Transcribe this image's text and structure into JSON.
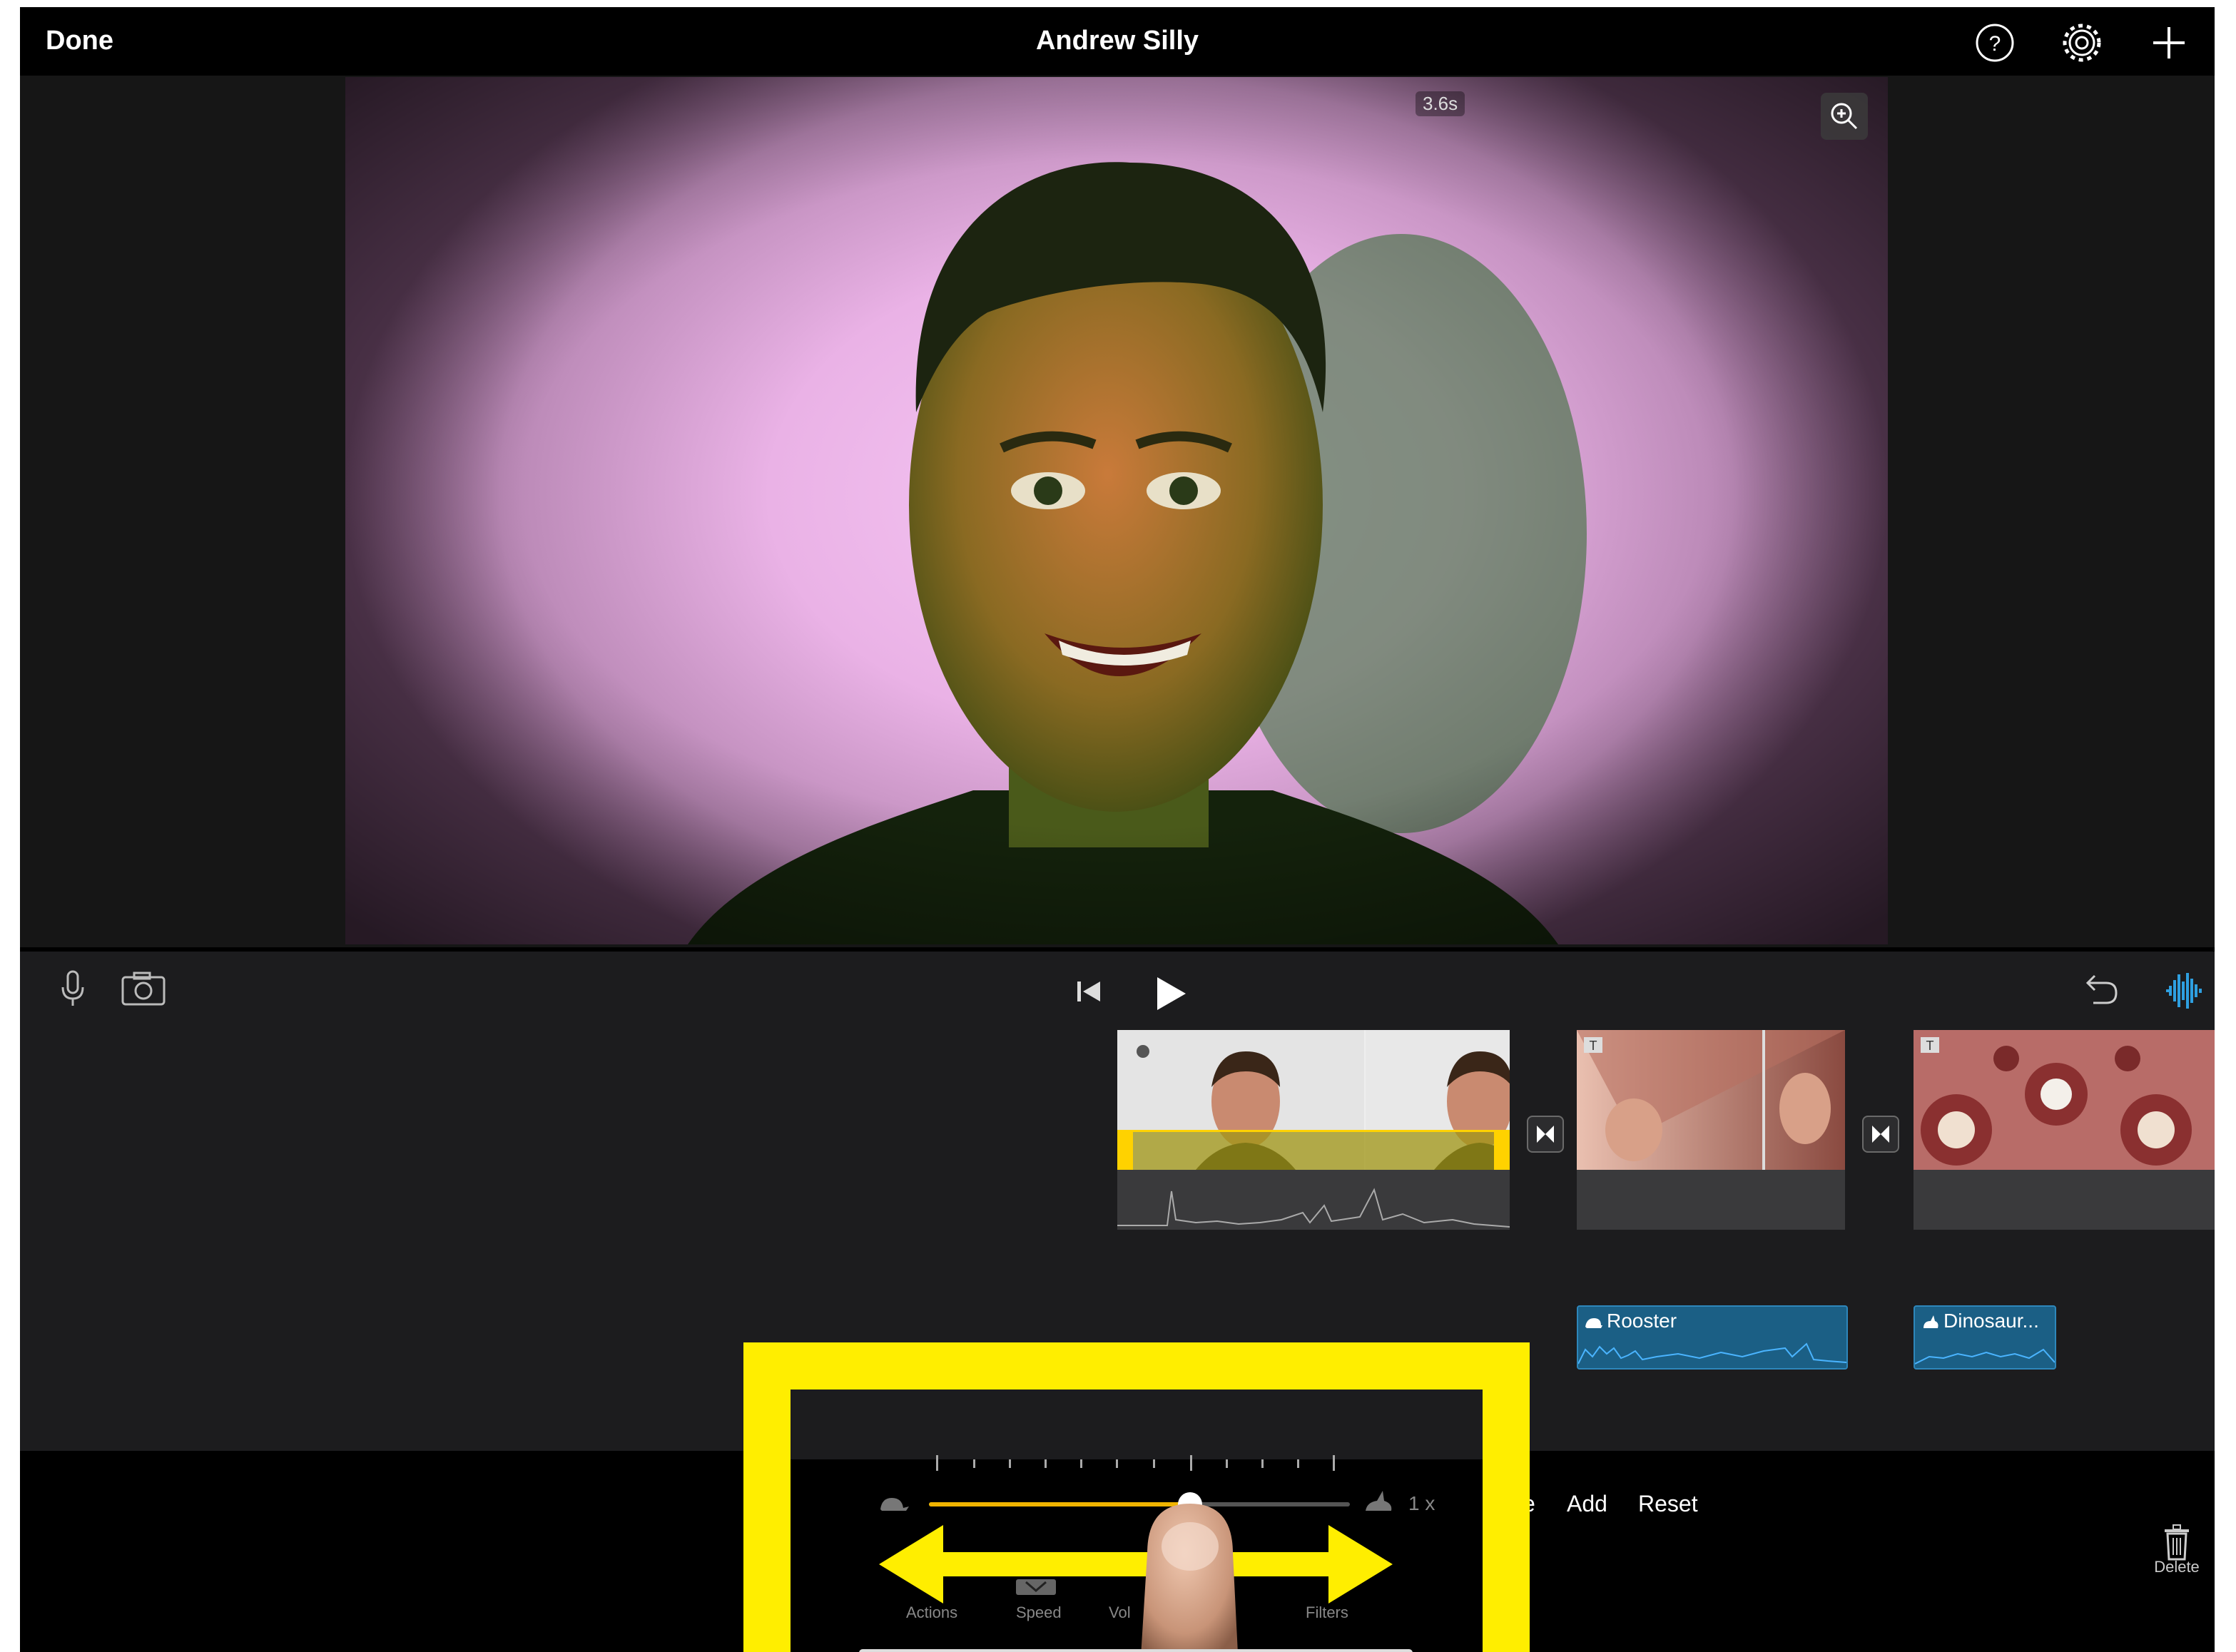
{
  "topbar": {
    "done_label": "Done",
    "title": "Andrew Silly"
  },
  "viewer": {
    "time_badge": "3.6s"
  },
  "bottom_tools": {
    "ize_label": "ze",
    "add_label": "Add",
    "reset_label": "Reset",
    "delete_label": "Delete"
  },
  "speed_panel": {
    "speed_value": "1 x",
    "speed_fraction": 0.62,
    "tabs": [
      "Actions",
      "Speed",
      "Vol",
      "Filters"
    ]
  },
  "audio_clips": [
    {
      "label": "Rooster"
    },
    {
      "label": "Dinosaur..."
    }
  ],
  "colors": {
    "accent_yellow": "#ffee00",
    "slider_fill": "#f0b400",
    "audio_blue": "#1b5f85",
    "audio_waveform_icon": "#2e9fe0"
  },
  "icons": [
    "help-icon",
    "settings-gear-icon",
    "plus-icon",
    "zoom-in-icon",
    "microphone-icon",
    "camera-icon",
    "skip-to-start-icon",
    "play-icon",
    "undo-icon",
    "audio-waveform-icon",
    "transition-icon",
    "trash-icon",
    "turtle-icon",
    "rabbit-icon"
  ]
}
